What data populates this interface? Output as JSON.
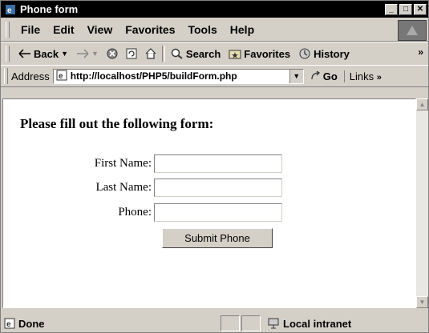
{
  "window": {
    "title": "Phone form",
    "buttons": {
      "minimize": "_",
      "maximize": "□",
      "close": "✕"
    }
  },
  "menu": {
    "items": [
      "File",
      "Edit",
      "View",
      "Favorites",
      "Tools",
      "Help"
    ]
  },
  "toolbar": {
    "back": "Back",
    "search": "Search",
    "favorites": "Favorites",
    "history": "History",
    "more": "»"
  },
  "address": {
    "label": "Address",
    "url": "http://localhost/PHP5/buildForm.php",
    "go": "Go",
    "links": "Links",
    "links_more": "»"
  },
  "form": {
    "heading": "Please fill out the following form:",
    "fields": [
      {
        "label": "First Name:",
        "value": ""
      },
      {
        "label": "Last Name:",
        "value": ""
      },
      {
        "label": "Phone:",
        "value": ""
      }
    ],
    "submit": "Submit Phone"
  },
  "status": {
    "text": "Done",
    "zone": "Local intranet"
  },
  "colors": {
    "titlebar": "#000000",
    "chrome": "#d4d0c8"
  }
}
